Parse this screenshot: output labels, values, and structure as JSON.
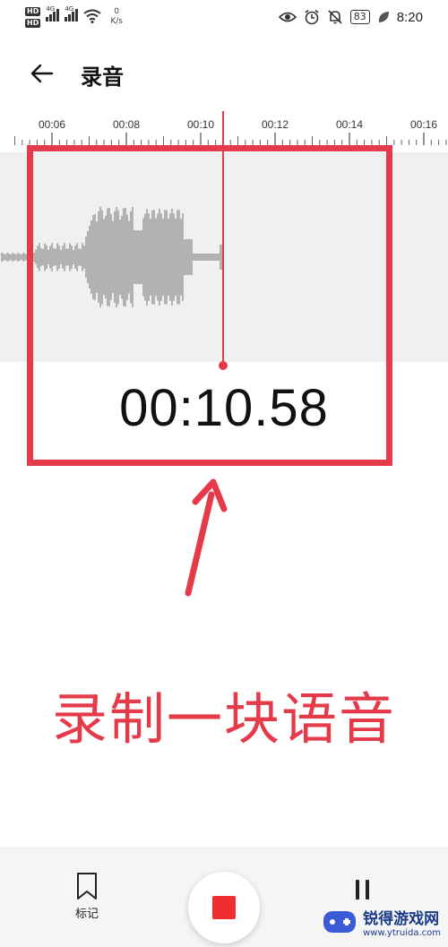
{
  "status_bar": {
    "hd_1": "HD",
    "hd_2": "HD",
    "net_1": "4G",
    "net_2": "4G",
    "speed_value": "0",
    "speed_unit": "K/s",
    "battery": "83",
    "time": "8:20"
  },
  "header": {
    "title": "录音"
  },
  "timeline": {
    "ticks": [
      "00:06",
      "00:08",
      "00:10",
      "00:12",
      "00:14",
      "00:16"
    ]
  },
  "recording": {
    "elapsed": "00:10.58"
  },
  "annotation": {
    "caption": "录制一块语音",
    "color": "#e53a4a"
  },
  "bottom_bar": {
    "mark_label": "标记",
    "stop_color": "#ef2f2f"
  },
  "watermark": {
    "name": "锐得游戏网",
    "url": "www.ytruida.com"
  },
  "icons": {
    "back": "arrow-left-icon",
    "mark": "bookmark-icon",
    "stop": "stop-icon",
    "pause": "pause-icon"
  }
}
